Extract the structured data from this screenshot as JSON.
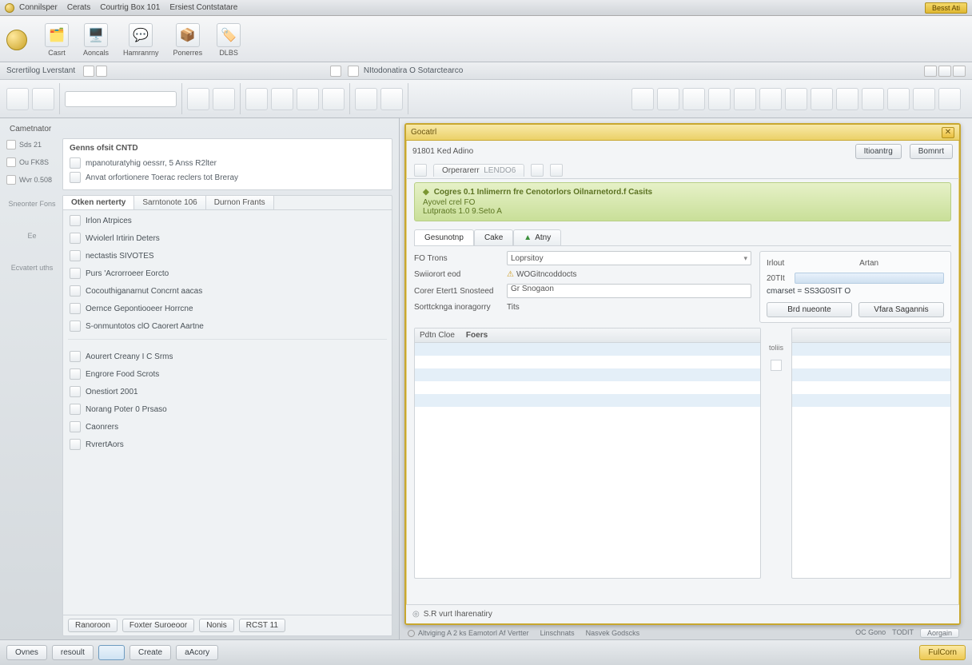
{
  "title": {
    "seg1": "Connilsper",
    "seg2": "Cerats",
    "seg3": "Courtrig Box 101",
    "seg4": "Ersiest Contstatare",
    "badge": "Besst Ati"
  },
  "ribbon": [
    {
      "label": "Casrt",
      "icon": "🗂️"
    },
    {
      "label": "Aoncals",
      "icon": "🖥️"
    },
    {
      "label": "Hamranrny",
      "icon": "💬"
    },
    {
      "label": "Ponerres",
      "icon": "📦"
    },
    {
      "label": "DLBS",
      "icon": "🏷️"
    }
  ],
  "subbar": {
    "label": "Scrertilog Lverstant",
    "mid": "NItodonatira O Sotarctearco"
  },
  "left": {
    "header": "Cametnator",
    "side": [
      {
        "label": "Sds 21"
      },
      {
        "label": "Ou FK8S"
      },
      {
        "label": "Wvr 0.508"
      }
    ],
    "content_title": "Genns ofsit CNTD",
    "content_lines": [
      "mpanoturatyhig oessrr, 5 Anss R2lter",
      "Anvat orfortionere Toerac reclers tot Breray"
    ],
    "cats": [
      "Sneonter Fons",
      "Ee",
      "Ecvatert uths"
    ],
    "tabs": [
      "Otken nerterty",
      "Sarntonote 106",
      "Durnon Frants"
    ],
    "items": [
      "Irlon Atrpices",
      "Wviolerl Irtirin Deters",
      "nectastis SIVOTES",
      "Purs   'Acrorroeer Eorcto",
      "Cocouthiganarnut Concrnt aacas",
      "Oernce Gepontiooeer Horrcne",
      "S-onmuntotos clO Caorert Aartne"
    ],
    "items2": [
      "Aourert Creany I C Srms",
      "Engrore Food Scrots",
      "Onestiort 2001",
      "Norang   Poter 0    Prsaso",
      "Caonrers",
      "RvrertAors"
    ],
    "foot": [
      "Ranoroon",
      "Foxter Suroeoor",
      "Nonis",
      "RCST 11"
    ]
  },
  "doc": {
    "title": "Gocatrl",
    "subtitle": "91801 Ked Adino",
    "buttons": [
      "Itioantrg",
      "Bomnrt"
    ],
    "tab1": "Orperarerr",
    "tab1b": "LENDO6",
    "banner": {
      "l1": "Cogres 0.1 Inlimerrn fre Cenotorlors Oilnarnetord.f Casits",
      "l2": "Ayovel crel FO",
      "l3": "Lutpraots 1.0 9.Seto A"
    },
    "navtabs": [
      "Gesunotnp",
      "Cake",
      "Atny"
    ],
    "form": {
      "l": [
        {
          "k": "FO Trons",
          "v": "Loprsitoy",
          "type": "select"
        },
        {
          "k": "Swiiorort eod",
          "v": "WOGitncoddocts",
          "type": "warn"
        },
        {
          "k": "Corer Etert1 Snosteed",
          "v": "Gr Snogaon",
          "type": "input"
        },
        {
          "k": "Sorttcknga inoragorry",
          "v": "Tits",
          "type": "text"
        }
      ],
      "r_top": {
        "k1": "Irlout",
        "k2": "Artan"
      },
      "r_detail": {
        "head1": "20TIt",
        "mid": "cmarset =  SS3G0SIT O",
        "btns": [
          "Brd nueonte",
          "Vfara Sagannis"
        ]
      }
    },
    "list_left": {
      "tabs": [
        "Pdtn Cloe",
        "Foers"
      ]
    },
    "list_label": "toliis",
    "footer": "S.R vurt Iharenatiry"
  },
  "under": {
    "l1": "Altviging A 2 ks Eamotorl Af Vertter",
    "l2": "Linschnats",
    "l3": "Nasvek Godscks",
    "r1": "OC Gono",
    "r2": "TODIT",
    "btn": "Aorgain"
  },
  "status": {
    "btns": [
      "Ovnes",
      "resoult",
      "",
      "Create",
      "aAcory"
    ],
    "rbtn": "FulCorn"
  }
}
